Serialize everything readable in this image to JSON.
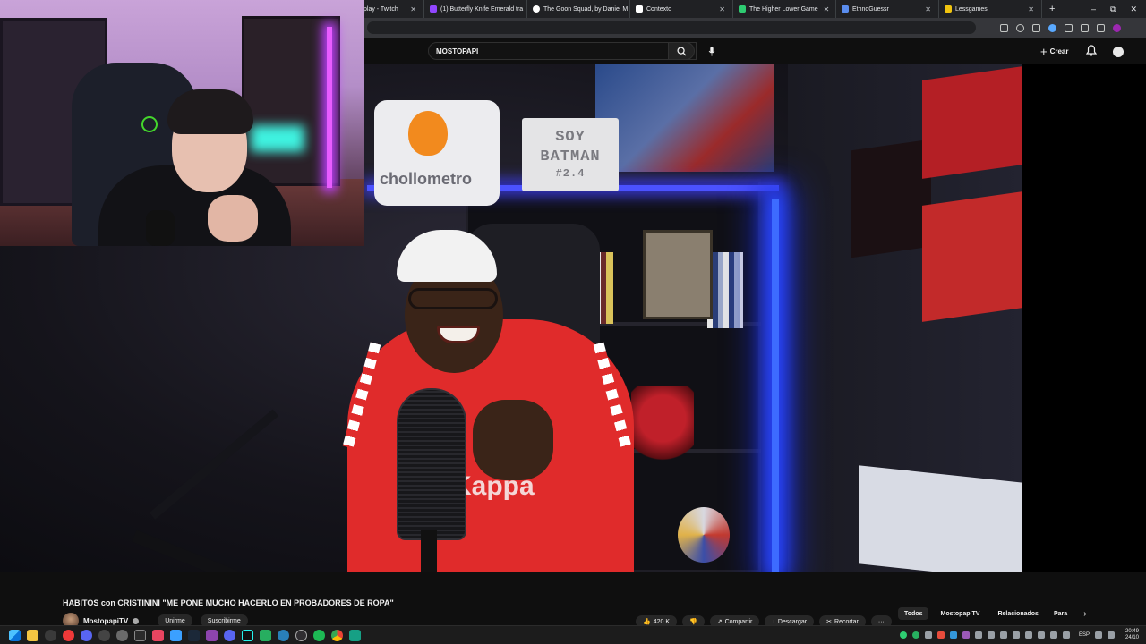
{
  "browser": {
    "tabs": [
      {
        "label": "play - Twitch",
        "color": "#9146ff"
      },
      {
        "label": "(1) Butterfly Knife Emerald tra",
        "color": "#9146ff"
      },
      {
        "label": "The Goon Squad, by Daniel M",
        "color": "#ffffff"
      },
      {
        "label": "Contexto",
        "color": "#ffffff"
      },
      {
        "label": "The Higher Lower Game",
        "color": "#2ecc71"
      },
      {
        "label": "EthnoGuessr",
        "color": "#5a8dee"
      },
      {
        "label": "Lessgames",
        "color": "#f1c40f"
      }
    ],
    "new_tab": "+",
    "controls": {
      "minimize": "–",
      "restore": "⧉",
      "close": "✕"
    }
  },
  "youtube": {
    "search_value": "MOSTOPAPI",
    "clear": "✕",
    "create_label": "Crear",
    "create_plus": "+"
  },
  "video": {
    "pillow_brand": "chollometro",
    "sign_line1": "SOY",
    "sign_line2": "BATMAN",
    "sign_line3": "#2.4",
    "shirt_brand": "Kappa",
    "title": "HABITOS con CRISTININI \"ME PONE MUCHO HACERLO EN PROBADORES DE ROPA\"",
    "channel": "MostopapiTV",
    "join_label": "Unirme",
    "subscribe_label": "Suscribirme",
    "actions": [
      {
        "label": "420 K",
        "icon": "like-icon"
      },
      {
        "label": "",
        "icon": "dislike-icon"
      },
      {
        "label": "Compartir",
        "icon": "share-icon"
      },
      {
        "label": "Descargar",
        "icon": "download-icon"
      },
      {
        "label": "Recortar",
        "icon": "clip-icon"
      },
      {
        "label": "···",
        "icon": "more-icon"
      }
    ]
  },
  "chips": [
    {
      "label": "Todos",
      "active": true
    },
    {
      "label": "MostopapiTV",
      "active": false
    },
    {
      "label": "Relacionados",
      "active": false
    },
    {
      "label": "Para",
      "active": false
    }
  ],
  "chip_next": "›",
  "taskbar": {
    "language": "ESP",
    "time": "20:49",
    "date": "24/10"
  }
}
